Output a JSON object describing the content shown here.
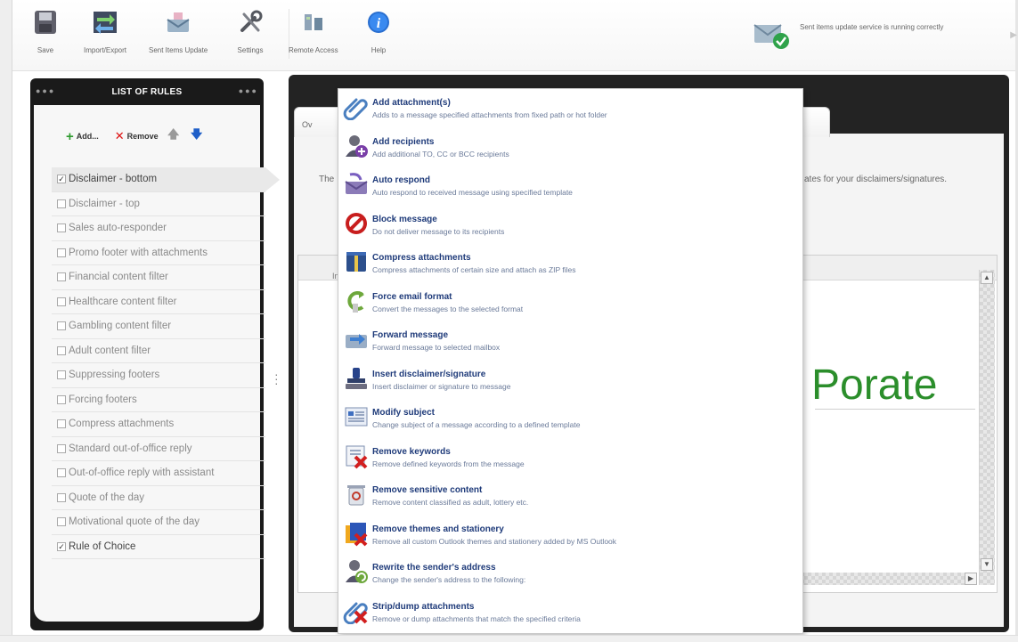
{
  "toolbar": {
    "buttons": [
      {
        "label": "Save",
        "icon": "save-icon"
      },
      {
        "label": "Import/Export",
        "icon": "import-export-icon"
      },
      {
        "label": "Sent Items Update",
        "icon": "sent-items-update-icon"
      },
      {
        "label": "Settings",
        "icon": "settings-icon"
      },
      {
        "label": "Remote Access",
        "icon": "remote-access-icon"
      },
      {
        "label": "Help",
        "icon": "help-icon"
      }
    ],
    "status_text": "Sent items update service is running correctly"
  },
  "rules_panel": {
    "title": "LIST OF RULES",
    "add_label": "Add...",
    "remove_label": "Remove",
    "rules": [
      {
        "label": "Disclaimer - bottom",
        "checked": true,
        "selected": true
      },
      {
        "label": "Disclaimer - top",
        "checked": false
      },
      {
        "label": "Sales auto-responder",
        "checked": false
      },
      {
        "label": "Promo footer with attachments",
        "checked": false
      },
      {
        "label": "Financial content filter",
        "checked": false
      },
      {
        "label": "Healthcare content filter",
        "checked": false
      },
      {
        "label": "Gambling content filter",
        "checked": false
      },
      {
        "label": "Adult content filter",
        "checked": false
      },
      {
        "label": "Suppressing footers",
        "checked": false
      },
      {
        "label": "Forcing footers",
        "checked": false
      },
      {
        "label": "Compress attachments",
        "checked": false
      },
      {
        "label": "Standard out-of-office reply",
        "checked": false
      },
      {
        "label": "Out-of-office reply with assistant",
        "checked": false
      },
      {
        "label": "Quote of the day",
        "checked": false
      },
      {
        "label": "Motivational quote of the day",
        "checked": false
      },
      {
        "label": "Rule of Choice",
        "checked": true
      }
    ]
  },
  "right_pane": {
    "tab_label": "Ov",
    "tab2_label": "In",
    "desc_left": "The",
    "desc_right": "ates for your disclaimers/signatures.",
    "editor_text": "Porate"
  },
  "menu": {
    "items": [
      {
        "title": "Add attachment(s)",
        "desc": "Adds to a message specified attachments from fixed path or hot folder",
        "icon": "paperclip-icon"
      },
      {
        "title": "Add recipients",
        "desc": "Add additional TO, CC or BCC recipients",
        "icon": "add-recipient-icon"
      },
      {
        "title": "Auto respond",
        "desc": "Auto respond to received message using specified template",
        "icon": "auto-respond-icon"
      },
      {
        "title": "Block message",
        "desc": "Do not deliver message to its recipients",
        "icon": "block-icon"
      },
      {
        "title": "Compress attachments",
        "desc": "Compress attachments of certain size and attach as ZIP files",
        "icon": "compress-icon"
      },
      {
        "title": "Force email format",
        "desc": "Convert the messages to the selected format",
        "icon": "format-icon"
      },
      {
        "title": "Forward message",
        "desc": "Forward message to selected mailbox",
        "icon": "forward-icon"
      },
      {
        "title": "Insert disclaimer/signature",
        "desc": "Insert disclaimer or signature to message",
        "icon": "stamp-icon"
      },
      {
        "title": "Modify subject",
        "desc": "Change subject of a message according to a defined template",
        "icon": "subject-icon"
      },
      {
        "title": "Remove keywords",
        "desc": "Remove defined keywords from the message",
        "icon": "remove-keywords-icon"
      },
      {
        "title": "Remove sensitive content",
        "desc": "Remove content classified as adult, lottery etc.",
        "icon": "recycle-bin-icon"
      },
      {
        "title": "Remove themes and stationery",
        "desc": "Remove all custom Outlook themes and stationery added by MS Outlook",
        "icon": "themes-icon"
      },
      {
        "title": "Rewrite the sender's address",
        "desc": "Change the sender's address to the following:",
        "icon": "rewrite-sender-icon"
      },
      {
        "title": "Strip/dump attachments",
        "desc": "Remove or dump attachments that match the specified criteria",
        "icon": "strip-attachments-icon"
      }
    ]
  },
  "colors": {
    "panel_dark": "#1a1a1a",
    "menu_title": "#1f3b7a",
    "editor_text": "#2b8e2b"
  }
}
